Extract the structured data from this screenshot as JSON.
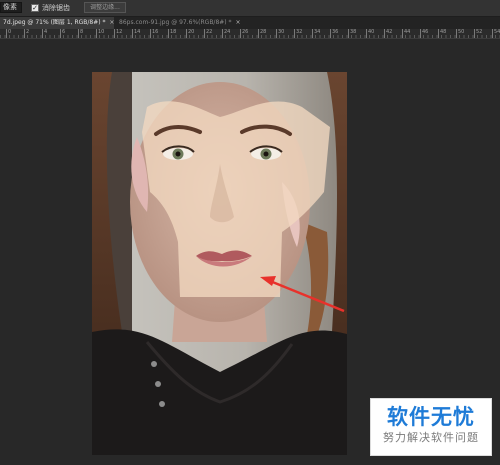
{
  "options_bar": {
    "field_value": "像素",
    "checkbox_label": "消除锯齿",
    "checkbox_mark": "✓",
    "button_label": "调整边缘..."
  },
  "tabs": [
    {
      "label": "7d.jpeg @ 71% (图层 1, RGB/8#) *",
      "close": "×",
      "active": true
    },
    {
      "label": "86ps.com-91.jpg @ 97.6%(RGB/8#) *",
      "close": "×",
      "active": false
    }
  ],
  "ruler": {
    "ticks": [
      "0",
      "2",
      "4",
      "6",
      "8",
      "10",
      "12",
      "14",
      "16",
      "18",
      "20",
      "22",
      "24",
      "26",
      "28",
      "30",
      "32",
      "34",
      "36",
      "38",
      "40",
      "42",
      "44",
      "46",
      "48",
      "50",
      "52",
      "54"
    ]
  },
  "canvas": {
    "image_subject": "portrait-photo-with-selection-overlay",
    "arrow_color": "#e8312b",
    "overlay_color": "#f2d9c0"
  },
  "watermark": {
    "title": "软件无忧",
    "subtitle": "努力解决软件问题",
    "title_color": "#1e7bd7"
  }
}
